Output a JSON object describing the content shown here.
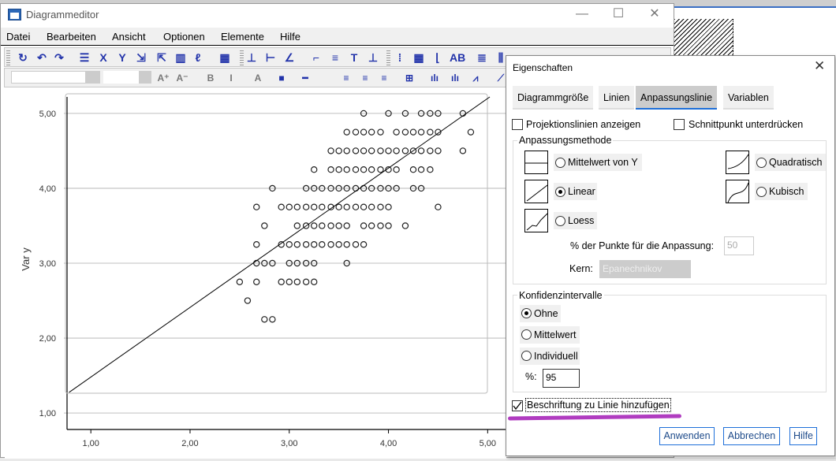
{
  "window": {
    "title": "Diagrammeditor",
    "minimize": "—",
    "maximize": "☐",
    "close": "✕"
  },
  "menu": [
    "Datei",
    "Bearbeiten",
    "Ansicht",
    "Optionen",
    "Elemente",
    "Hilfe"
  ],
  "toolbar1": [
    "rotate-icon",
    "undo-icon",
    "redo-icon",
    "properties-icon",
    "x-axis-icon",
    "y-axis-icon",
    "rescale-icon",
    "resize-icon",
    "3d-icon",
    "lasso-icon",
    "data-label-icon",
    "y-axis-line-icon",
    "x-axis-line-icon",
    "diagonal-icon",
    "title-icon",
    "legend-icon",
    "text-box-icon",
    "footnote-icon",
    "grid-dots-icon",
    "grid-icon",
    "axis-ticks-icon",
    "ab-labels-icon",
    "bars-icon",
    "columns-icon"
  ],
  "toolbar1_glyphs": [
    "↻",
    "↶",
    "↷",
    "☰",
    "X",
    "Y",
    "⇲",
    "⇱",
    "▥",
    "ℓ",
    "▦",
    "⊥",
    "⊢",
    "∠",
    "⌐",
    "≡",
    "T",
    "⊥",
    "⁞",
    "▦",
    "⌊",
    "AB",
    "≣",
    "⫼"
  ],
  "toolbar2": {
    "font_value": "",
    "size_value": "",
    "glyphs": [
      "A⁺",
      "A⁻",
      "B",
      "I",
      "A",
      "■",
      "━",
      "≡",
      "≡",
      "≡",
      "⊞",
      "ılı",
      "ılı",
      "⩘",
      "⟋"
    ],
    "names": [
      "font-grow-icon",
      "font-shrink-icon",
      "bold-icon",
      "italic-icon",
      "text-color-icon",
      "fill-color-icon",
      "line-style-icon",
      "align-left-icon",
      "align-center-icon",
      "align-right-icon",
      "frame-icon",
      "bar-chart-icon",
      "stacked-bar-icon",
      "line-chart-icon",
      "fit-line-icon"
    ]
  },
  "chart_data": {
    "type": "scatter",
    "ylabel": "Var y",
    "xlabel": "",
    "xlim": [
      0.76,
      5.22
    ],
    "ylim": [
      0.78,
      5.22
    ],
    "x_ticks": [
      "1,00",
      "2,00",
      "3,00",
      "4,00",
      "5,00"
    ],
    "y_ticks": [
      "1,00",
      "2,00",
      "3,00",
      "4,00",
      "5,00"
    ],
    "grid": "horizontal",
    "marker": "hollow-circle",
    "fit_line": {
      "type": "linear",
      "intercept": 0.55,
      "slope": 0.93
    },
    "rows": [
      {
        "y": 5.0,
        "x": [
          3.75,
          4.0,
          4.17,
          4.33,
          4.42,
          4.5,
          4.75
        ]
      },
      {
        "y": 4.75,
        "x": [
          3.58,
          3.67,
          3.75,
          3.83,
          3.92,
          4.08,
          4.17,
          4.25,
          4.33,
          4.42,
          4.5,
          4.83
        ]
      },
      {
        "y": 4.5,
        "x": [
          3.42,
          3.5,
          3.58,
          3.67,
          3.75,
          3.83,
          3.92,
          4.0,
          4.08,
          4.17,
          4.25,
          4.33,
          4.42,
          4.5,
          4.75
        ]
      },
      {
        "y": 4.25,
        "x": [
          3.25,
          3.42,
          3.5,
          3.58,
          3.67,
          3.75,
          3.83,
          3.92,
          4.0,
          4.08,
          4.25,
          4.33,
          4.42
        ]
      },
      {
        "y": 4.0,
        "x": [
          2.83,
          3.17,
          3.25,
          3.33,
          3.42,
          3.5,
          3.58,
          3.67,
          3.75,
          3.83,
          3.92,
          4.0,
          4.08,
          4.25,
          4.33
        ]
      },
      {
        "y": 3.75,
        "x": [
          2.67,
          2.92,
          3.0,
          3.08,
          3.17,
          3.25,
          3.33,
          3.42,
          3.5,
          3.58,
          3.67,
          3.75,
          3.83,
          3.92,
          4.0,
          4.5
        ]
      },
      {
        "y": 3.5,
        "x": [
          2.75,
          3.08,
          3.17,
          3.25,
          3.33,
          3.42,
          3.5,
          3.58,
          3.75,
          3.83,
          3.92,
          4.0,
          4.17
        ]
      },
      {
        "y": 3.25,
        "x": [
          2.67,
          2.92,
          3.0,
          3.08,
          3.17,
          3.25,
          3.33,
          3.42,
          3.5,
          3.58,
          3.67,
          3.75
        ]
      },
      {
        "y": 3.0,
        "x": [
          2.67,
          2.75,
          2.83,
          3.0,
          3.08,
          3.17,
          3.25,
          3.58
        ]
      },
      {
        "y": 2.75,
        "x": [
          2.5,
          2.67,
          2.92,
          3.0,
          3.08,
          3.17,
          3.25
        ]
      },
      {
        "y": 2.5,
        "x": [
          2.58
        ]
      },
      {
        "y": 2.25,
        "x": [
          2.75,
          2.83
        ]
      }
    ]
  },
  "dialog": {
    "title": "Eigenschaften",
    "close": "✕",
    "tabs": [
      "Diagrammgröße",
      "Linien",
      "Anpassungslinie",
      "Variablen"
    ],
    "active_tab": "Anpassungslinie",
    "projection_lines": {
      "label": "Projektionslinien anzeigen",
      "checked": false
    },
    "suppress_intercept": {
      "label": "Schnittpunkt unterdrücken",
      "checked": false
    },
    "method_group": "Anpassungsmethode",
    "methods": [
      {
        "label": "Mittelwert von Y",
        "selected": false
      },
      {
        "label": "Linear",
        "selected": true
      },
      {
        "label": "Loess",
        "selected": false
      },
      {
        "label": "Quadratisch",
        "selected": false
      },
      {
        "label": "Kubisch",
        "selected": false
      }
    ],
    "points_label": "% der Punkte für die Anpassung:",
    "points_value": "50",
    "kernel_label": "Kern:",
    "kernel_value": "Epanechnikov",
    "ci_group": "Konfidenzintervalle",
    "ci": [
      {
        "label": "Ohne",
        "selected": true
      },
      {
        "label": "Mittelwert",
        "selected": false
      },
      {
        "label": "Individuell",
        "selected": false
      }
    ],
    "percent_label": "%:",
    "percent_value": "95",
    "add_label": {
      "label": "Beschriftung zu Linie hinzufügen",
      "checked": true
    },
    "highlight_color": "#b03cc0",
    "buttons": [
      "Anwenden",
      "Abbrechen",
      "Hilfe"
    ]
  }
}
